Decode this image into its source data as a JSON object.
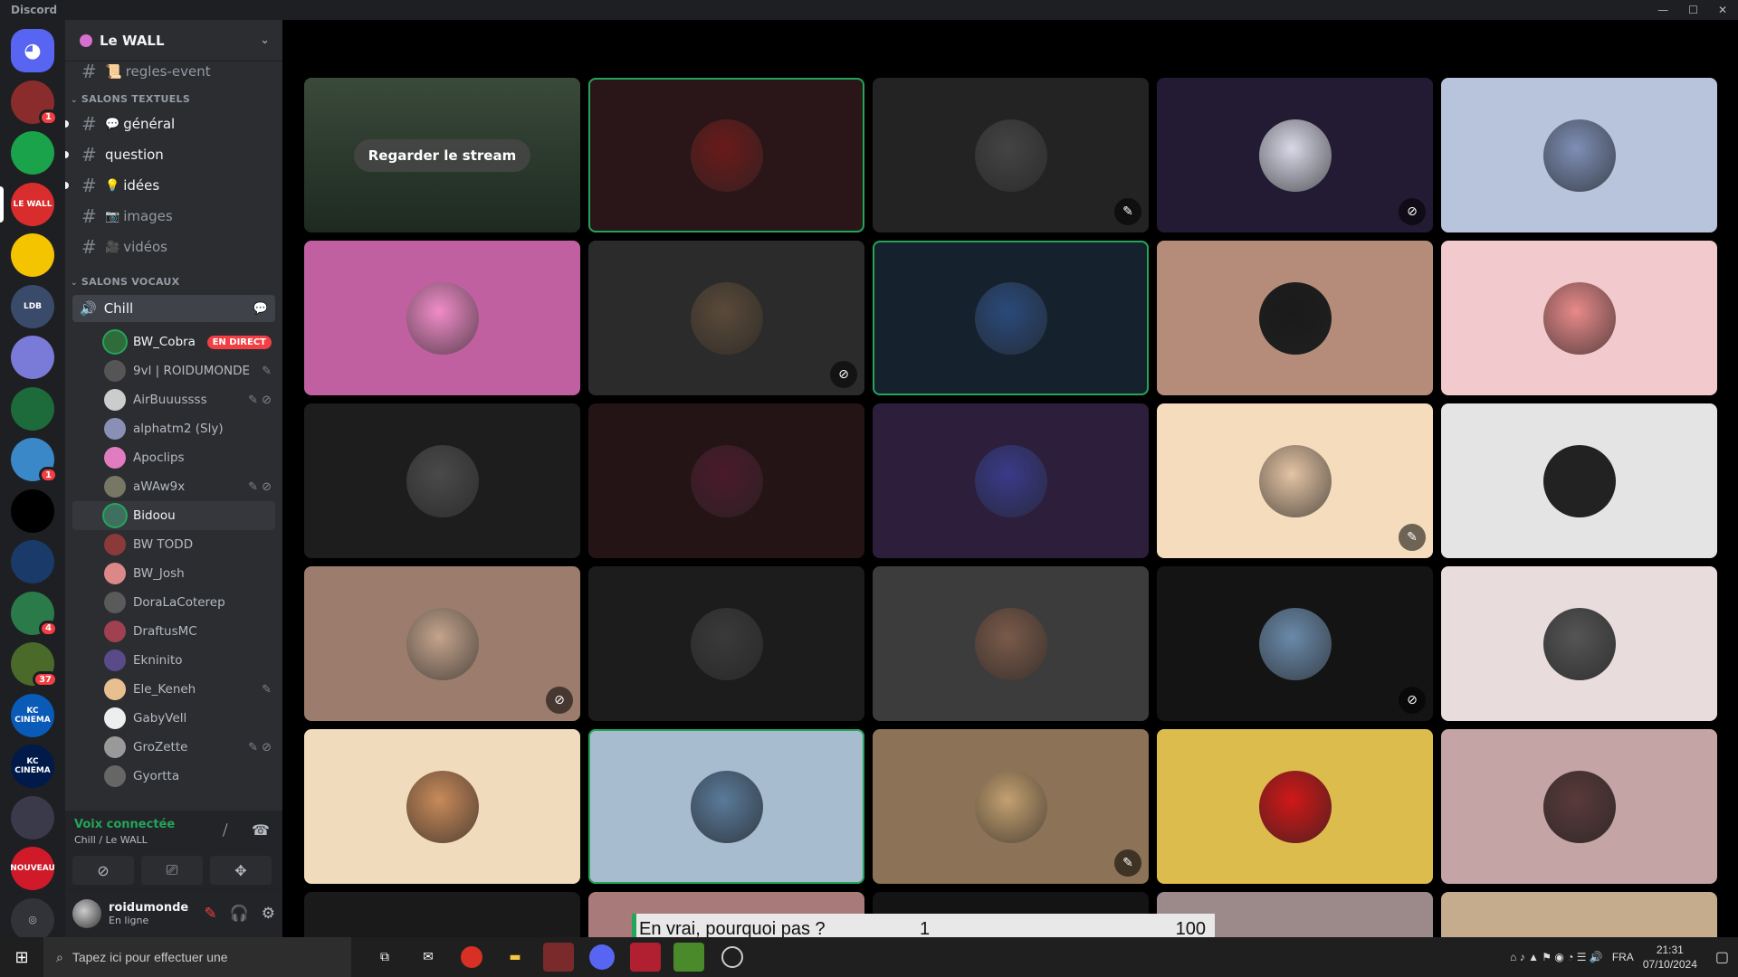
{
  "window": {
    "title": "Discord"
  },
  "server": {
    "name": "Le WALL"
  },
  "channels": {
    "top": "regles-event",
    "text_category": "SALONS TEXTUELS",
    "text": [
      {
        "label": "général",
        "emoji": "💬"
      },
      {
        "label": "question",
        "emoji": ""
      },
      {
        "label": "idées",
        "emoji": "💡"
      },
      {
        "label": "images",
        "emoji": "📷"
      },
      {
        "label": "vidéos",
        "emoji": "🎥"
      }
    ],
    "voice_category": "SALONS VOCAUX",
    "voice_channel": "Chill"
  },
  "voice_users": [
    {
      "name": "BW_Cobra",
      "live": "EN DIRECT",
      "color": "#2f6b3b"
    },
    {
      "name": "9vl | ROIDUMONDE",
      "icons": "✎",
      "color": "#555"
    },
    {
      "name": "AirBuuussss",
      "icons": "✎ ⊘",
      "color": "#ccc"
    },
    {
      "name": "alphatm2 (Sly)",
      "color": "#8a8fb5"
    },
    {
      "name": "Apoclips",
      "color": "#e07cbf"
    },
    {
      "name": "aWAw9x",
      "icons": "✎ ⊘",
      "color": "#776"
    },
    {
      "name": "Bidoou",
      "color": "#3f6f5f"
    },
    {
      "name": "BW TODD",
      "color": "#8b3a3a"
    },
    {
      "name": "BW_Josh",
      "color": "#d88"
    },
    {
      "name": "DoraLaCoterep",
      "color": "#5a5a5a"
    },
    {
      "name": "DraftusMC",
      "color": "#a04050"
    },
    {
      "name": "Ekninito",
      "color": "#5a4a8a"
    },
    {
      "name": "Ele_Keneh",
      "icons": "✎",
      "color": "#e8c090"
    },
    {
      "name": "GabyVell",
      "color": "#eee"
    },
    {
      "name": "GroZette",
      "icons": "✎ ⊘",
      "color": "#999"
    },
    {
      "name": "Gyortta",
      "color": "#666"
    }
  ],
  "voice_panel": {
    "status": "Voix connectée",
    "location": "Chill / Le WALL"
  },
  "user_panel": {
    "username": "roidumonde",
    "status": "En ligne"
  },
  "stream": {
    "watch_label": "Regarder le stream"
  },
  "tiles": [
    {
      "bg": "#2c3a2c",
      "circle": "",
      "muted": "",
      "speaking": false,
      "stream": true
    },
    {
      "bg": "#2a1618",
      "circle": "#6a1a1a",
      "muted": "",
      "speaking": true
    },
    {
      "bg": "#232323",
      "circle": "#444",
      "muted": "✎",
      "speaking": false
    },
    {
      "bg": "#231b33",
      "circle": "#d8d8e8",
      "muted": "⊘",
      "speaking": false
    },
    {
      "bg": "#b8c4dc",
      "circle": "#7e8fb6",
      "muted": "",
      "speaking": false
    },
    {
      "bg": "#c060a0",
      "circle": "#f08cc8",
      "muted": "",
      "speaking": false
    },
    {
      "bg": "#2b2b2b",
      "circle": "#5a4a3a",
      "muted": "⊘",
      "speaking": false
    },
    {
      "bg": "#15222e",
      "circle": "#2a4a7a",
      "muted": "",
      "speaking": true
    },
    {
      "bg": "#b58c7a",
      "circle": "#1a1a1a",
      "muted": "",
      "speaking": false
    },
    {
      "bg": "#f2c9cc",
      "circle": "#e88a8a",
      "muted": "",
      "speaking": false
    },
    {
      "bg": "#1d1d1d",
      "circle": "#4a4a4a",
      "muted": "",
      "speaking": false
    },
    {
      "bg": "#241416",
      "circle": "#4a1a2a",
      "muted": "",
      "speaking": false
    },
    {
      "bg": "#2d1f3c",
      "circle": "#3a3a8a",
      "muted": "",
      "speaking": false
    },
    {
      "bg": "#f4dcbc",
      "circle": "#e4c4a4",
      "muted": "✎",
      "speaking": false
    },
    {
      "bg": "#e4e4e4",
      "circle": "#222",
      "muted": "",
      "speaking": false
    },
    {
      "bg": "#9c7c6c",
      "circle": "#c4a48c",
      "muted": "⊘",
      "speaking": false
    },
    {
      "bg": "#1c1c1c",
      "circle": "#3a3a3a",
      "muted": "",
      "speaking": false
    },
    {
      "bg": "#3c3c3c",
      "circle": "#7a5a4a",
      "muted": "",
      "speaking": false
    },
    {
      "bg": "#141414",
      "circle": "#6a8aaa",
      "muted": "⊘",
      "speaking": false
    },
    {
      "bg": "#e8dcdc",
      "circle": "#555",
      "muted": "",
      "speaking": false
    },
    {
      "bg": "#f0dcbc",
      "circle": "#c88a5a",
      "muted": "",
      "speaking": false
    },
    {
      "bg": "#a8bcd0",
      "circle": "#5a7a9a",
      "muted": "",
      "speaking": true
    },
    {
      "bg": "#8c7256",
      "circle": "#c4a070",
      "muted": "✎",
      "speaking": false
    },
    {
      "bg": "#dcbc4c",
      "circle": "#d01818",
      "muted": "",
      "speaking": false
    },
    {
      "bg": "#c4a4a4",
      "circle": "#5a3a3a",
      "muted": "",
      "speaking": false
    },
    {
      "bg": "#1a1a1a",
      "circle": "",
      "muted": "",
      "speaking": false
    },
    {
      "bg": "#a87a7a",
      "circle": "",
      "muted": "",
      "speaking": false
    },
    {
      "bg": "#141414",
      "circle": "",
      "muted": "",
      "speaking": false
    },
    {
      "bg": "#9c8a8a",
      "circle": "",
      "muted": "",
      "speaking": false
    },
    {
      "bg": "#c4ac8c",
      "circle": "",
      "muted": "",
      "speaking": false
    }
  ],
  "overlay": {
    "question": "En vrai, pourquoi pas ?",
    "left_value": "1",
    "right_value": "100"
  },
  "servers": [
    {
      "label": "",
      "color": "#5865f2",
      "badge": ""
    },
    {
      "label": "",
      "color": "#8b2c2c",
      "badge": "1"
    },
    {
      "label": "",
      "color": "#1aa34a",
      "badge": ""
    },
    {
      "label": "LE WALL",
      "color": "#d92d2d",
      "badge": ""
    },
    {
      "label": "",
      "color": "#f5c400",
      "badge": ""
    },
    {
      "label": "LDB",
      "color": "#3a4a6a",
      "badge": ""
    },
    {
      "label": "",
      "color": "#7a7ad8",
      "badge": ""
    },
    {
      "label": "",
      "color": "#1d6a3a",
      "badge": ""
    },
    {
      "label": "",
      "color": "#3a88c8",
      "badge": "1"
    },
    {
      "label": "",
      "color": "#000",
      "badge": ""
    },
    {
      "label": "",
      "color": "#1a3a6a",
      "badge": ""
    },
    {
      "label": "",
      "color": "#2a7a4a",
      "badge": "4"
    },
    {
      "label": "",
      "color": "#4a6a2a",
      "badge": "37"
    },
    {
      "label": "KC CINEMA",
      "color": "#0a5ab8",
      "badge": ""
    },
    {
      "label": "KC CINEMA",
      "color": "#001a4a",
      "badge": ""
    },
    {
      "label": "",
      "color": "#3a3a4a",
      "badge": ""
    },
    {
      "label": "NOUVEAU",
      "color": "#d01a2a",
      "badge": ""
    },
    {
      "label": "",
      "color": "#313338",
      "badge": ""
    }
  ],
  "taskbar": {
    "search_placeholder": "Tapez ici pour effectuer une",
    "lang": "FRA",
    "time": "21:31",
    "date": "07/10/2024"
  }
}
